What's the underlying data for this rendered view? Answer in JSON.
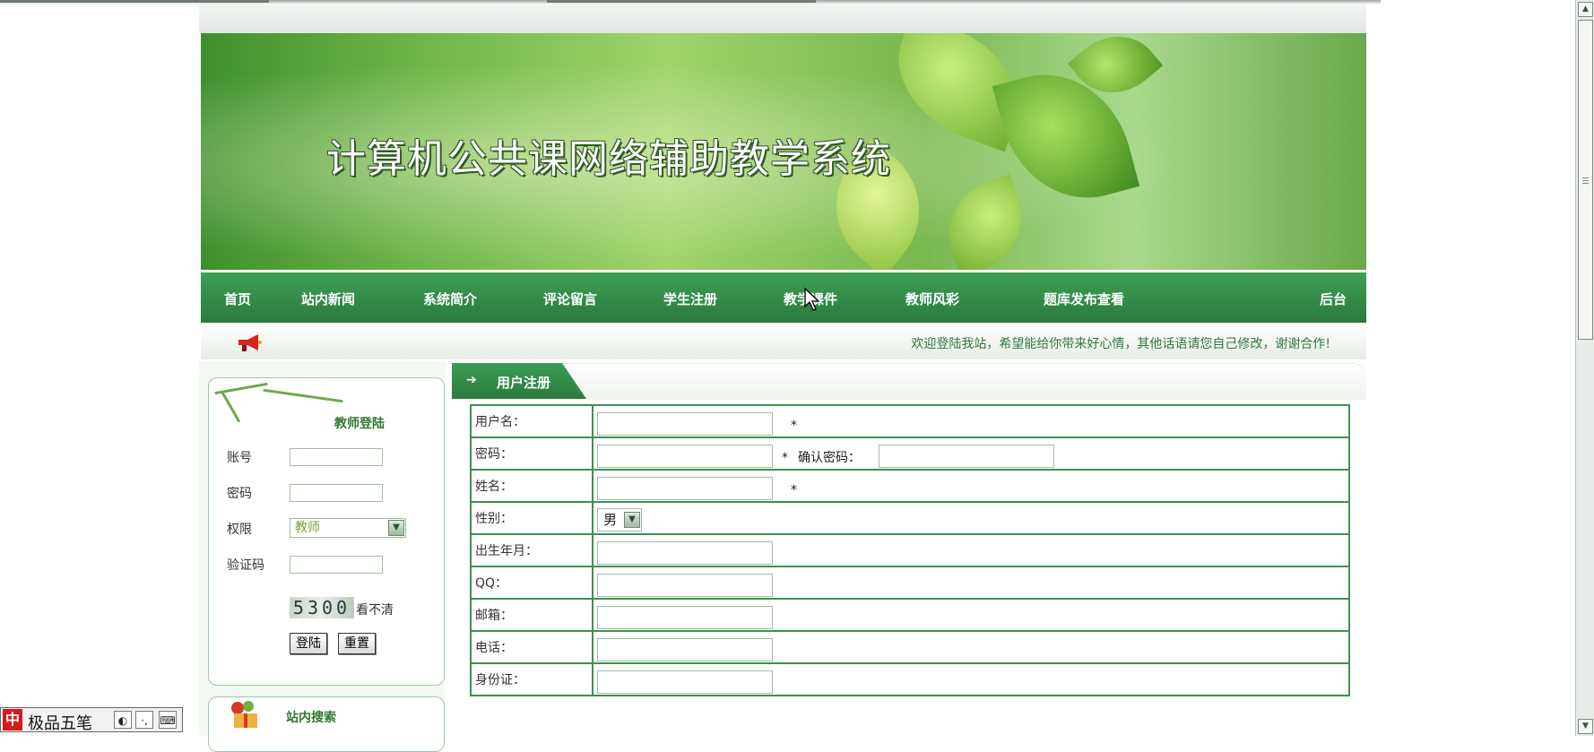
{
  "banner": {
    "title": "计算机公共课网络辅助教学系统"
  },
  "nav": {
    "items": [
      {
        "label": "首页"
      },
      {
        "label": "站内新闻"
      },
      {
        "label": "系统简介"
      },
      {
        "label": "评论留言"
      },
      {
        "label": "学生注册"
      },
      {
        "label": "教学课件"
      },
      {
        "label": "教师风彩"
      },
      {
        "label": "题库发布查看"
      },
      {
        "label": "后台"
      }
    ]
  },
  "welcome": {
    "text": "欢迎登陆我站，希望能给你带来好心情，其他话语请您自己修改，谢谢合作!"
  },
  "login": {
    "title": "教师登陆",
    "account_label": "账号",
    "password_label": "密码",
    "role_label": "权限",
    "role_value": "教师",
    "captcha_label": "验证码",
    "captcha_code": "5300",
    "captcha_hint": "看不清",
    "login_button": "登陆",
    "reset_button": "重置"
  },
  "search": {
    "title": "站内搜索"
  },
  "main": {
    "tab_label": "用户注册",
    "form": {
      "username_label": "用户名：",
      "password_label": "密码：",
      "confirm_label": "确认密码：",
      "name_label": "姓名：",
      "sex_label": "性别：",
      "sex_value": "男",
      "birth_label": "出生年月：",
      "qq_label": "QQ：",
      "email_label": "邮箱：",
      "phone_label": "电话：",
      "idcard_label": "身份证：",
      "required_mark": "*"
    }
  },
  "ime": {
    "mode": "中",
    "name": "极品五笔"
  }
}
